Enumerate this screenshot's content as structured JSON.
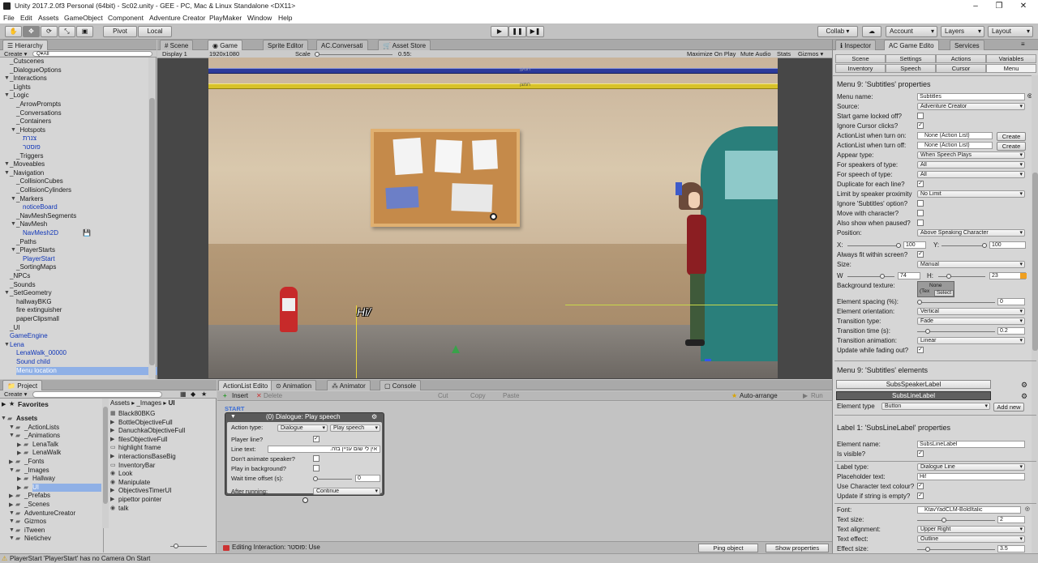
{
  "window": {
    "title": "Unity 2017.2.0f3 Personal (64bit) - Sc02.unity - GEE - PC, Mac & Linux Standalone <DX11>"
  },
  "menu": [
    "File",
    "Edit",
    "Assets",
    "GameObject",
    "Component",
    "Adventure Creator",
    "PlayMaker",
    "Window",
    "Help"
  ],
  "toolbar": {
    "pivot": "Pivot",
    "local": "Local",
    "collab": "Collab ▾",
    "account": "Account",
    "layers": "Layers",
    "layout": "Layout"
  },
  "hierarchy": {
    "tab": "Hierarchy",
    "create": "Create ▾",
    "search": "Q▾All",
    "items": [
      {
        "label": "_Cutscenes",
        "indent": 1,
        "arrow": false
      },
      {
        "label": "_DialogueOptions",
        "indent": 1,
        "arrow": false
      },
      {
        "label": "_Interactions",
        "indent": 1,
        "arrow": true
      },
      {
        "label": "_Lights",
        "indent": 1,
        "arrow": false
      },
      {
        "label": "_Logic",
        "indent": 1,
        "arrow": true
      },
      {
        "label": "_ArrowPrompts",
        "indent": 2,
        "arrow": false
      },
      {
        "label": "_Conversations",
        "indent": 2,
        "arrow": false
      },
      {
        "label": "_Containers",
        "indent": 2,
        "arrow": false
      },
      {
        "label": "_Hotspots",
        "indent": 2,
        "arrow": true
      },
      {
        "label": "צנרת",
        "indent": 3,
        "arrow": false,
        "blue": true
      },
      {
        "label": "פוסטר",
        "indent": 3,
        "arrow": false,
        "blue": true
      },
      {
        "label": "_Triggers",
        "indent": 2,
        "arrow": false
      },
      {
        "label": "_Moveables",
        "indent": 1,
        "arrow": true
      },
      {
        "label": "_Navigation",
        "indent": 1,
        "arrow": true
      },
      {
        "label": "_CollisionCubes",
        "indent": 2,
        "arrow": false
      },
      {
        "label": "_CollisionCylinders",
        "indent": 2,
        "arrow": false
      },
      {
        "label": "_Markers",
        "indent": 2,
        "arrow": true
      },
      {
        "label": "noticeBoard",
        "indent": 3,
        "arrow": false,
        "blue": true
      },
      {
        "label": "_NavMeshSegments",
        "indent": 2,
        "arrow": false
      },
      {
        "label": "_NavMesh",
        "indent": 2,
        "arrow": true
      },
      {
        "label": "NavMesh2D",
        "indent": 3,
        "arrow": false,
        "blue": true
      },
      {
        "label": "_Paths",
        "indent": 2,
        "arrow": false
      },
      {
        "label": "_PlayerStarts",
        "indent": 2,
        "arrow": true
      },
      {
        "label": "PlayerStart",
        "indent": 3,
        "arrow": false,
        "blue": true
      },
      {
        "label": "_SortingMaps",
        "indent": 2,
        "arrow": false
      },
      {
        "label": "_NPCs",
        "indent": 1,
        "arrow": false
      },
      {
        "label": "_Sounds",
        "indent": 1,
        "arrow": false
      },
      {
        "label": "_SetGeometry",
        "indent": 1,
        "arrow": true
      },
      {
        "label": "hallwayBKG",
        "indent": 2,
        "arrow": false
      },
      {
        "label": "fire extinguisher",
        "indent": 2,
        "arrow": false
      },
      {
        "label": "paperClipsmall",
        "indent": 2,
        "arrow": false
      },
      {
        "label": "_UI",
        "indent": 1,
        "arrow": false
      },
      {
        "label": "GameEngine",
        "indent": 1,
        "arrow": false,
        "blue": true
      },
      {
        "label": "Lena",
        "indent": 1,
        "arrow": true,
        "blue": true
      },
      {
        "label": "LenaWalk_00000",
        "indent": 2,
        "arrow": false,
        "blue": true
      },
      {
        "label": "Sound child",
        "indent": 2,
        "arrow": false,
        "blue": true
      },
      {
        "label": "Menu location",
        "indent": 2,
        "arrow": false,
        "blue": true,
        "sel": true
      }
    ]
  },
  "sceneTabs": [
    "Scene",
    "Game",
    "Sprite Editor",
    "AC.Conversati",
    "Asset Store"
  ],
  "gameBar": {
    "display": "Display 1",
    "res": "1920x1080",
    "scale": "Scale",
    "scaleVal": "0.55:",
    "maximize": "Maximize On Play",
    "mute": "Mute Audio",
    "stats": "Stats",
    "gizmos": "Gizmos ▾"
  },
  "game": {
    "pipeSign1": "חנוקן",
    "pipeSign2": "חמצן",
    "subtitle": "Hi/"
  },
  "inspector": {
    "tabs": [
      "Inspector",
      "AC Game Edito",
      "Services"
    ],
    "subtabs1": [
      "Scene",
      "Settings",
      "Actions",
      "Variables"
    ],
    "subtabs2": [
      "Inventory",
      "Speech",
      "Cursor",
      "Menu"
    ],
    "menuHeader": "Menu 9: 'Subtitles' properties",
    "rows": [
      {
        "label": "Menu name:",
        "kind": "tf",
        "value": "Subtitles"
      },
      {
        "label": "Source:",
        "kind": "dd",
        "value": "Adventure Creator"
      },
      {
        "label": "Start game locked off?",
        "kind": "cb",
        "value": ""
      },
      {
        "label": "Ignore Cursor clicks?",
        "kind": "cb",
        "value": "✓"
      },
      {
        "label": "ActionList when turn on:",
        "kind": "obj",
        "value": "None (Action List)"
      },
      {
        "label": "ActionList when turn off:",
        "kind": "obj",
        "value": "None (Action List)"
      },
      {
        "label": "Appear type:",
        "kind": "dd",
        "value": "When Speech Plays"
      },
      {
        "label": "For speakers of type:",
        "kind": "dd",
        "value": "All"
      },
      {
        "label": "For speech of type:",
        "kind": "dd",
        "value": "All"
      },
      {
        "label": "Duplicate for each line?",
        "kind": "cb",
        "value": "✓"
      },
      {
        "label": "Limit by speaker proximity",
        "kind": "dd",
        "value": "No Limit"
      },
      {
        "label": "Ignore 'Subtitles' option?",
        "kind": "cb",
        "value": ""
      },
      {
        "label": "Move with character?",
        "kind": "cb",
        "value": ""
      },
      {
        "label": "Also show when paused?",
        "kind": "cb",
        "value": ""
      },
      {
        "label": "Position:",
        "kind": "dd",
        "value": "Above Speaking Character"
      }
    ],
    "x": "X:",
    "xVal": "100",
    "y": "Y:",
    "yVal": "100",
    "alwaysFit": "Always fit within screen?",
    "size": "Size:",
    "sizeVal": "Manual",
    "w": "W",
    "wVal": "74",
    "h": "H:",
    "hVal": "23",
    "bgTex": "Background texture:",
    "bgNone": "None",
    "bgTex2": "(Tex",
    "bgSelect": "Select",
    "rows2": [
      {
        "label": "Element spacing (%):",
        "kind": "slider",
        "value": "0"
      },
      {
        "label": "Element orientation:",
        "kind": "dd",
        "value": "Vertical"
      },
      {
        "label": "Transition type:",
        "kind": "dd",
        "value": "Fade"
      },
      {
        "label": "Transition time (s):",
        "kind": "slider",
        "value": "0.2"
      },
      {
        "label": "Transition animation:",
        "kind": "dd",
        "value": "Linear"
      },
      {
        "label": "Update while fading out?",
        "kind": "cb",
        "value": "✓"
      }
    ],
    "create": "Create",
    "elementsHeader": "Menu 9: 'Subtitles' elements",
    "elements": [
      "SubsSpeakerLabel",
      "SubsLineLabel"
    ],
    "elementType": "Element type",
    "elementTypeVal": "Button",
    "addNew": "Add new",
    "labelHeader": "Label 1: 'SubsLineLabel' properties",
    "rows3": [
      {
        "label": "Element name:",
        "kind": "tf",
        "value": "SubsLineLabel"
      },
      {
        "label": "Is visible?",
        "kind": "cb",
        "value": "✓"
      }
    ],
    "rows4": [
      {
        "label": "Label type:",
        "kind": "dd",
        "value": "Dialogue Line"
      },
      {
        "label": "Placeholder text:",
        "kind": "tf",
        "value": "Hi!"
      },
      {
        "label": "Use Character text colour?",
        "kind": "cb",
        "value": "✓"
      },
      {
        "label": "Update if string is empty?",
        "kind": "cb",
        "value": "✓"
      }
    ],
    "rows5": [
      {
        "label": "Font:",
        "kind": "obj",
        "value": "KtavYadCLM-BoldItalic"
      },
      {
        "label": "Text size:",
        "kind": "slider",
        "value": "2"
      },
      {
        "label": "Text alignment:",
        "kind": "dd",
        "value": "Upper Right"
      },
      {
        "label": "Text effect:",
        "kind": "dd",
        "value": "Outline"
      },
      {
        "label": "Effect size:",
        "kind": "slider",
        "value": "3.5"
      }
    ]
  },
  "project": {
    "tab": "Project",
    "create": "Create ▾",
    "favorites": "Favorites",
    "tree": [
      {
        "label": "Assets",
        "indent": 0,
        "bold": true
      },
      {
        "label": "_ActionLists",
        "indent": 1
      },
      {
        "label": "_Animations",
        "indent": 1
      },
      {
        "label": "LenaTalk",
        "indent": 2
      },
      {
        "label": "LenaWalk",
        "indent": 2
      },
      {
        "label": "_Fonts",
        "indent": 1
      },
      {
        "label": "_Images",
        "indent": 1
      },
      {
        "label": "Hallway",
        "indent": 2
      },
      {
        "label": "UI",
        "indent": 2,
        "sel": true
      },
      {
        "label": "_Prefabs",
        "indent": 1
      },
      {
        "label": "_Scenes",
        "indent": 1
      },
      {
        "label": "AdventureCreator",
        "indent": 1
      },
      {
        "label": "Gizmos",
        "indent": 1
      },
      {
        "label": "iTween",
        "indent": 1
      },
      {
        "label": "Nietichev",
        "indent": 1
      }
    ],
    "breadcrumb": [
      "Assets",
      "_Images",
      "UI"
    ],
    "files": [
      "Black80BKG",
      "BottleObjectiveFull",
      "DanuchkaObjectiveFull",
      "filesObjectiveFull",
      "highlight frame",
      "interactionsBaseBig",
      "InventoryBar",
      "Look",
      "Manipulate",
      "ObjectivesTimerUI",
      "pipettor pointer",
      "talk"
    ]
  },
  "aclist": {
    "tabs": [
      "ActionList Edito",
      "Animation",
      "Animator",
      "Console"
    ],
    "insert": "Insert",
    "delete": "Delete",
    "cut": "Cut",
    "copy": "Copy",
    "paste": "Paste",
    "autoArrange": "Auto-arrange",
    "run": "Run",
    "start": "START",
    "nodeTitle": "(0) Dialogue: Play speech",
    "actionType": "Action type:",
    "actionTypeA": "Dialogue",
    "actionTypeB": "Play speech",
    "playerLine": "Player line?",
    "lineText": "Line text:",
    "lineTextVal": "אין לי שום עניין בזה.",
    "dontAnimate": "Don't animate speaker?",
    "playBg": "Play in background?",
    "waitOffset": "Wait time offset (s):",
    "waitVal": "0",
    "afterRunning": "After running:",
    "afterVal": "Continue",
    "editing": "Editing Interaction: פוסטר: Use",
    "ping": "Ping object",
    "showProps": "Show properties"
  },
  "status": "PlayerStart 'PlayerStart' has no Camera On Start",
  "colors": {
    "accent": "#3d6fd6",
    "selection": "#8fb0e6",
    "pipeBlue": "#2c3a9a",
    "pipeYellow": "#d8c229"
  }
}
